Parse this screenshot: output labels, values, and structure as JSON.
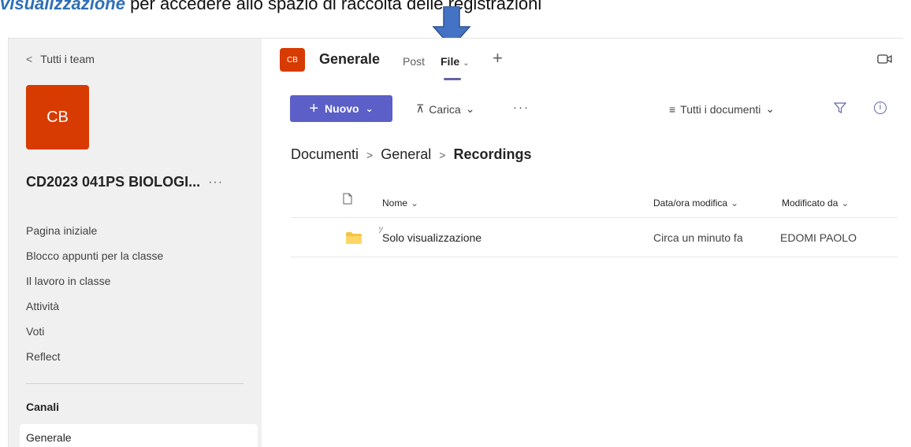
{
  "caption": {
    "emphasis": "visualizzazione",
    "text": " per accedere allo spazio di raccolta delle registrazioni"
  },
  "sidebar": {
    "back_label": "Tutti i team",
    "team_initials": "CB",
    "team_name": "CD2023 041PS BIOLOGI...",
    "more_label": "···",
    "nav_items": [
      {
        "label": "Pagina iniziale"
      },
      {
        "label": "Blocco appunti per la classe"
      },
      {
        "label": "Il lavoro in classe"
      },
      {
        "label": "Attività"
      },
      {
        "label": "Voti"
      },
      {
        "label": "Reflect"
      }
    ],
    "channels_heading": "Canali",
    "channels": [
      {
        "label": "Generale"
      }
    ]
  },
  "header": {
    "channel_initials": "CB",
    "channel_title": "Generale",
    "tabs": [
      {
        "label": "Post"
      },
      {
        "label": "File"
      }
    ],
    "add_tab": "+"
  },
  "toolbar": {
    "new_label": "Nuovo",
    "upload_label": "Carica",
    "more_label": "···",
    "view_label": "Tutti i documenti"
  },
  "breadcrumb": [
    "Documenti",
    "General",
    "Recordings"
  ],
  "file_list": {
    "columns": {
      "name": "Nome",
      "modified": "Data/ora modifica",
      "modified_by": "Modificato da"
    },
    "rows": [
      {
        "name": "Solo visualizzazione",
        "modified": "Circa un minuto fa",
        "modified_by": "EDOMI PAOLO"
      }
    ]
  },
  "colors": {
    "accent": "#5b5fc7",
    "team_avatar": "#d83b01",
    "arrow": "#4472c4"
  }
}
